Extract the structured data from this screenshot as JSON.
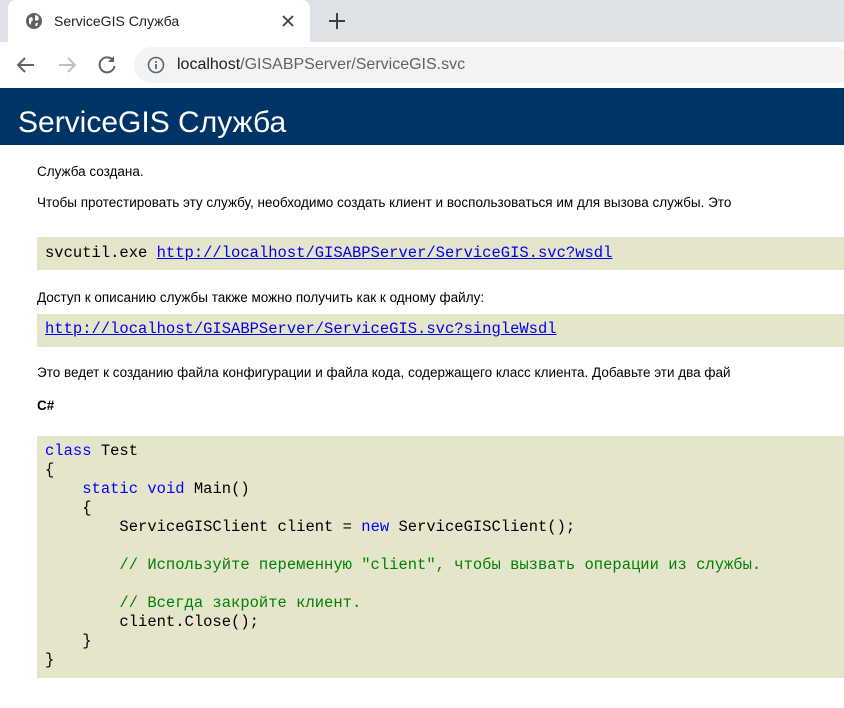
{
  "browser": {
    "tab_title": "ServiceGIS Служба",
    "url_host": "localhost",
    "url_path": "/GISABPServer/ServiceGIS.svc"
  },
  "page": {
    "heading": "ServiceGIS Служба",
    "created": "Служба создана.",
    "test_intro": "Чтобы протестировать эту службу, необходимо создать клиент и воспользоваться им для вызова службы. Это",
    "svcutil_cmd": "svcutil.exe ",
    "wsdl_link": "http://localhost/GISABPServer/ServiceGIS.svc?wsdl",
    "single_file_text": "Доступ к описанию службы также можно получить как к одному файлу:",
    "single_wsdl_link": "http://localhost/GISABPServer/ServiceGIS.svc?singleWsdl",
    "generate_text": "Это ведет к созданию файла конфигурации и файла кода, содержащего класс клиента. Добавьте эти два фай",
    "lang_label": "C#",
    "code": {
      "l1_kw": "class",
      "l1_rest": " Test",
      "l2": "{",
      "l3_indent": "    ",
      "l3_kw1": "static",
      "l3_sp": " ",
      "l3_kw2": "void",
      "l3_rest": " Main()",
      "l4": "    {",
      "l5_a": "        ServiceGISClient client = ",
      "l5_kw": "new",
      "l5_b": " ServiceGISClient();",
      "l7": "        // Используйте переменную \"client\", чтобы вызвать операции из службы.",
      "l9": "        // Всегда закройте клиент.",
      "l10": "        client.Close();",
      "l11": "    }",
      "l12": "}"
    }
  }
}
